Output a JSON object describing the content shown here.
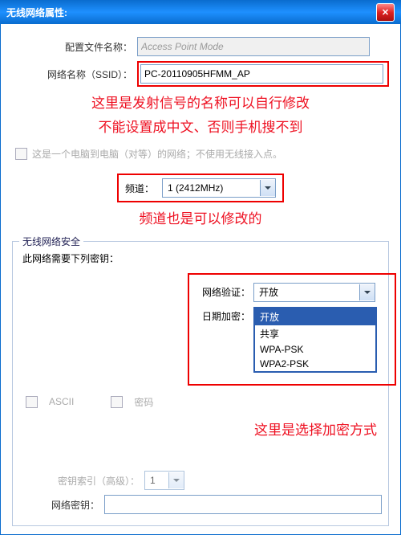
{
  "titlebar": {
    "title": "无线网络属性:"
  },
  "profile": {
    "label": "配置文件名称：",
    "value": "Access Point Mode"
  },
  "ssid": {
    "label": "网络名称（SSID）：",
    "value": "PC-20110905HFMM_AP"
  },
  "notes": {
    "ssid1": "这里是发射信号的名称可以自行修改",
    "ssid2": "不能设置成中文、否则手机搜不到",
    "channel": "频道也是可以修改的",
    "encrypt": "这里是选择加密方式"
  },
  "adhoc": {
    "label": "这是一个电脑到电脑（对等）的网络；不使用无线接入点。"
  },
  "channel": {
    "label": "频道：",
    "value": "1 (2412MHz)"
  },
  "security": {
    "legend": "无线网络安全",
    "need_key": "此网络需要下列密钥：",
    "auth_label": "网络验证：",
    "auth_value": "开放",
    "encrypt_label": "日期加密：",
    "options": [
      "开放",
      "共享",
      "WPA-PSK",
      "WPA2-PSK"
    ],
    "ascii": "ASCII",
    "passcode": "密码",
    "key_index_label": "密钥索引（高级）：",
    "key_index_value": "1",
    "net_key_label": "网络密钥："
  }
}
